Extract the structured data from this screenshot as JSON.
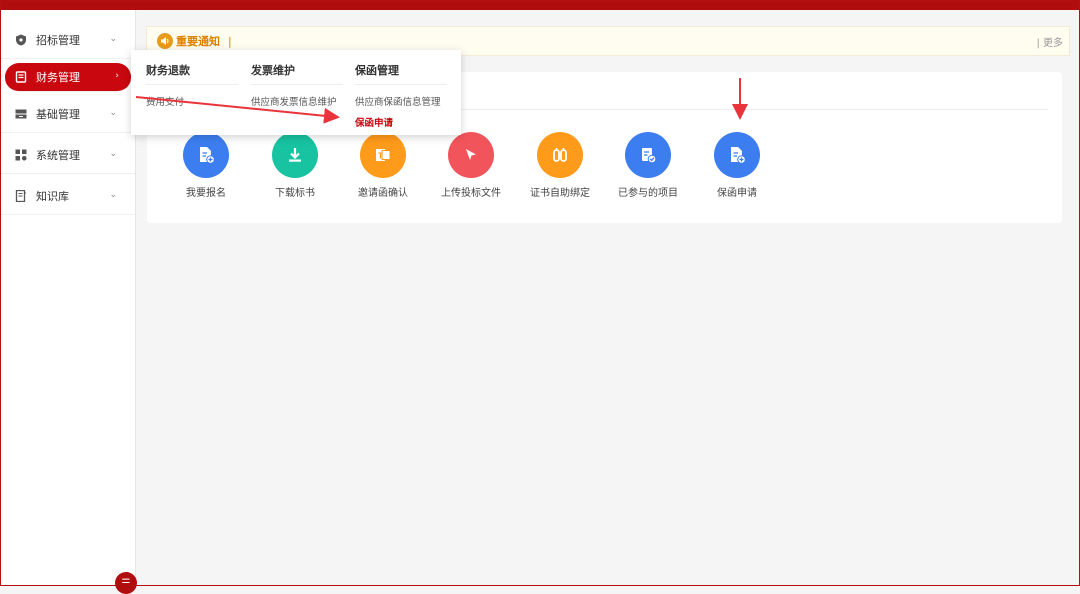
{
  "sidebar": {
    "items": [
      {
        "label": "招标管理",
        "icon": "shield-icon"
      },
      {
        "label": "财务管理",
        "icon": "document-icon"
      },
      {
        "label": "基础管理",
        "icon": "drawer-icon"
      },
      {
        "label": "系统管理",
        "icon": "grid-icon"
      },
      {
        "label": "知识库",
        "icon": "book-icon"
      }
    ],
    "toggle_icon": "menu-collapse-icon"
  },
  "notice": {
    "title": "重要通知",
    "separator": "|",
    "more": "| 更多"
  },
  "dropdown": {
    "columns": [
      {
        "header": "财务退款",
        "links": [
          "费用支付"
        ]
      },
      {
        "header": "发票维护",
        "links": [
          "供应商发票信息维护"
        ]
      },
      {
        "header": "保函管理",
        "links": [
          "供应商保函信息管理",
          "保函申请"
        ]
      }
    ]
  },
  "quick_actions": [
    {
      "label": "我要报名",
      "color": "#3c7ef0",
      "icon": "file-add-icon"
    },
    {
      "label": "下载标书",
      "color": "#17c3a0",
      "icon": "download-icon"
    },
    {
      "label": "邀请函确认",
      "color": "#ff9b1a",
      "icon": "office-doc-icon"
    },
    {
      "label": "上传投标文件",
      "color": "#f2545b",
      "icon": "cursor-icon"
    },
    {
      "label": "证书自助绑定",
      "color": "#ff9b1a",
      "icon": "certificate-icon"
    },
    {
      "label": "已参与的项目",
      "color": "#3c7ef0",
      "icon": "doc-check-icon"
    },
    {
      "label": "保函申请",
      "color": "#3c7ef0",
      "icon": "file-add-icon"
    }
  ],
  "colors": {
    "brand": "#b00d0e",
    "annotation_arrow": "#e8343a"
  }
}
